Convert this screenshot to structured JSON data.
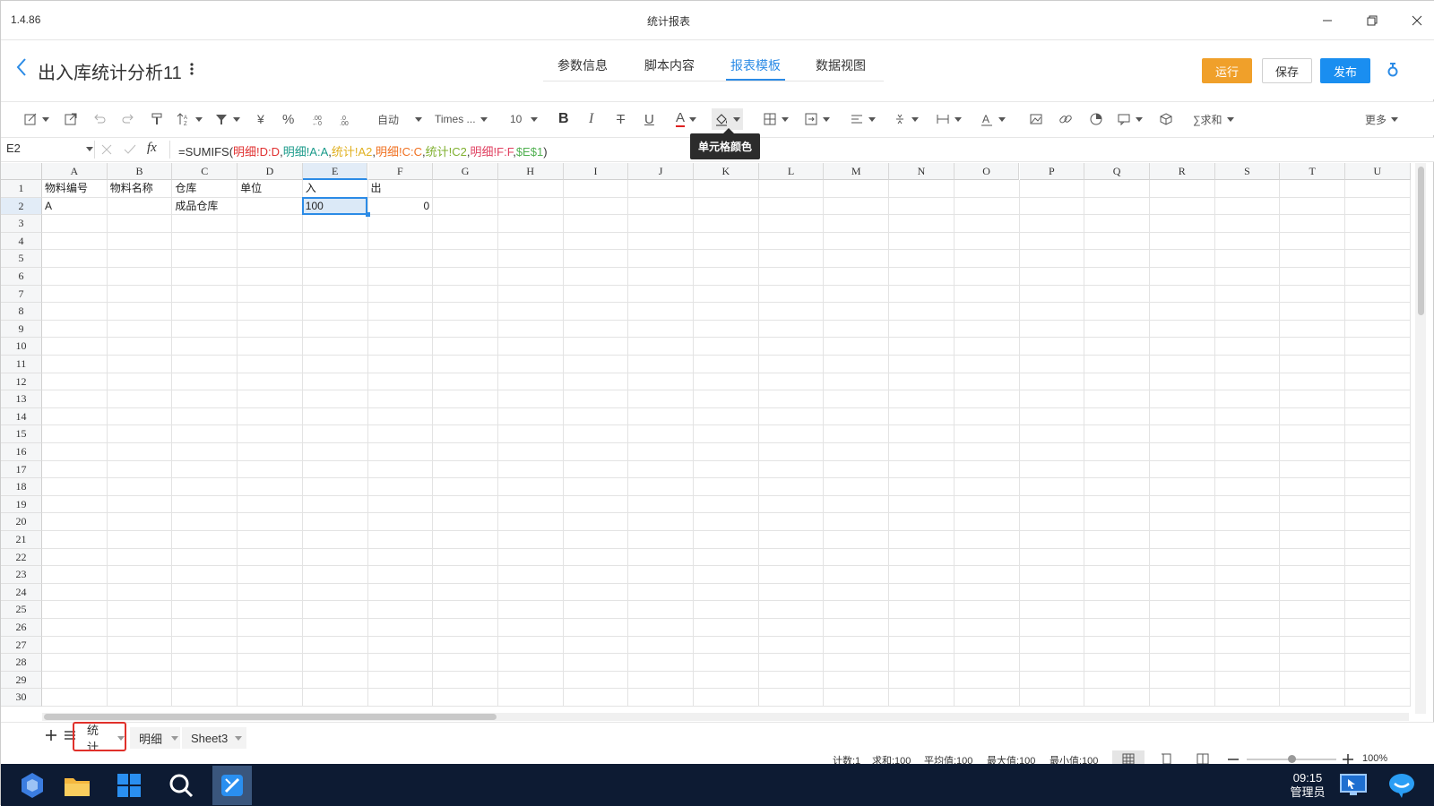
{
  "window": {
    "version": "1.4.86",
    "title": "统计报表"
  },
  "header": {
    "doc_title": "出入库统计分析11",
    "tabs": [
      "参数信息",
      "脚本内容",
      "报表模板",
      "数据视图"
    ],
    "active_tab": "报表模板",
    "run_label": "运行",
    "save_label": "保存",
    "publish_label": "发布",
    "accent": "#2b8be6"
  },
  "toolbar": {
    "number_format": "自动",
    "font_name": "Times ...",
    "font_size": "10",
    "currency": "¥",
    "percent": "%",
    "bold": "B",
    "italic": "I",
    "strike": "T",
    "underline": "U",
    "font_color": "A",
    "sum_label": "∑求和",
    "more_label": "更多",
    "tooltip": "单元格颜色"
  },
  "formula_bar": {
    "cell_ref": "E2",
    "fx": "fx",
    "formula_parts": [
      {
        "text": "=SUMIFS(",
        "color": "#333333"
      },
      {
        "text": "明细!D:D",
        "color": "#e03030"
      },
      {
        "text": ",",
        "color": "#333333"
      },
      {
        "text": "明细!A:A",
        "color": "#1a9a8a"
      },
      {
        "text": ",",
        "color": "#333333"
      },
      {
        "text": "统计!A2",
        "color": "#e0b020"
      },
      {
        "text": ",",
        "color": "#333333"
      },
      {
        "text": "明细!C:C",
        "color": "#f07020"
      },
      {
        "text": ",",
        "color": "#333333"
      },
      {
        "text": "统计!C2",
        "color": "#80b030"
      },
      {
        "text": ",",
        "color": "#333333"
      },
      {
        "text": "明细!F:F",
        "color": "#e04060"
      },
      {
        "text": ",",
        "color": "#333333"
      },
      {
        "text": "$E$1",
        "color": "#50b050"
      },
      {
        "text": ")",
        "color": "#333333"
      }
    ]
  },
  "sheet": {
    "columns": [
      "A",
      "B",
      "C",
      "D",
      "E",
      "F",
      "G",
      "H",
      "I",
      "J",
      "K",
      "L",
      "M",
      "N",
      "O",
      "P",
      "Q",
      "R",
      "S",
      "T",
      "U"
    ],
    "rows": [
      "1",
      "2",
      "3",
      "4",
      "5",
      "6",
      "7",
      "8",
      "9",
      "10",
      "11",
      "12",
      "13",
      "14",
      "15",
      "16",
      "17",
      "18",
      "19",
      "20",
      "21",
      "22",
      "23",
      "24",
      "25",
      "26",
      "27",
      "28",
      "29",
      "30"
    ],
    "cells": {
      "A1": "物料编号",
      "B1": "物料名称",
      "C1": "仓库",
      "D1": "单位",
      "E1": "入",
      "F1": "出",
      "A2": "A",
      "C2": "成品仓库",
      "E2": "100",
      "F2": "0"
    },
    "selected": "E2"
  },
  "sheet_tabs": [
    "统计",
    "明细",
    "Sheet3"
  ],
  "active_sheet": "统计",
  "status": {
    "count": "计数:1",
    "sum": "求和:100",
    "avg": "平均值:100",
    "max": "最大值:100",
    "min": "最小值:100",
    "zoom": "100%"
  },
  "taskbar": {
    "time": "09:15",
    "user": "管理员"
  }
}
